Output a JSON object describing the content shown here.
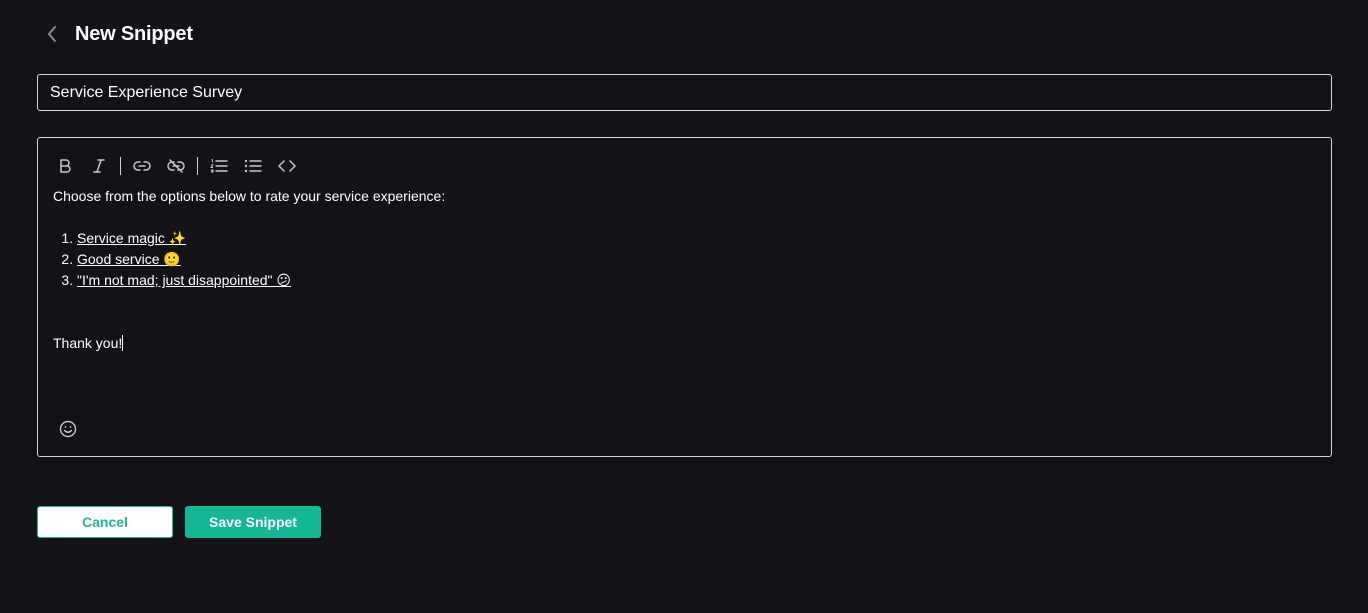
{
  "header": {
    "back_icon": "chevron-left-icon",
    "title": "New Snippet"
  },
  "snippet_title": {
    "value": "Service Experience Survey",
    "placeholder": ""
  },
  "toolbar": {
    "items": [
      "bold-icon",
      "italic-icon",
      "link-icon",
      "unlink-icon",
      "ordered-list-icon",
      "bullet-list-icon",
      "code-icon"
    ]
  },
  "editor": {
    "intro": "Choose from the options below to rate your service experience:",
    "options": [
      {
        "label": "Service magic ✨"
      },
      {
        "label": "Good service 🙂"
      },
      {
        "label": "\"I'm not mad; just disappointed\" 😕"
      }
    ],
    "closing": "Thank you!",
    "emoji_icon": "smiley-icon"
  },
  "actions": {
    "cancel_label": "Cancel",
    "save_label": "Save Snippet"
  },
  "colors": {
    "background": "#121217",
    "accent": "#14b896",
    "border": "#d6d6da"
  }
}
